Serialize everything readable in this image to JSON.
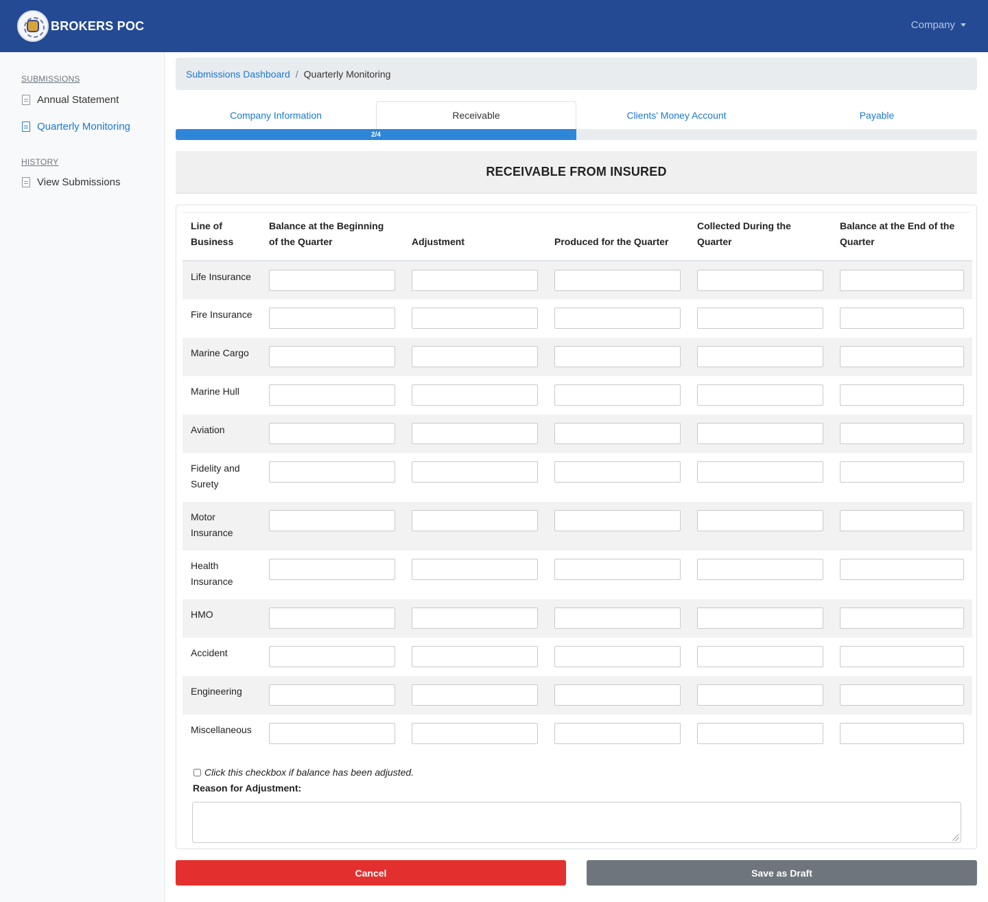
{
  "app": {
    "brand": "BROKERS POC",
    "company_menu": "Company"
  },
  "sidebar": {
    "submissions_heading": "SUBMISSIONS",
    "history_heading": "HISTORY",
    "items": [
      {
        "label": "Annual Statement"
      },
      {
        "label": "Quarterly Monitoring"
      },
      {
        "label": "View Submissions"
      }
    ]
  },
  "breadcrumb": {
    "link": "Submissions Dashboard",
    "separator": "/",
    "current": "Quarterly Monitoring"
  },
  "tabs": [
    {
      "label": "Company Information"
    },
    {
      "label": "Receivable"
    },
    {
      "label": "Clients' Money Account"
    },
    {
      "label": "Payable"
    }
  ],
  "progress": {
    "label": "2/4",
    "fraction": 0.5
  },
  "section": {
    "title": "RECEIVABLE FROM INSURED"
  },
  "table": {
    "headers": [
      "Line of Business",
      "Balance at the Beginning of the Quarter",
      "Adjustment",
      "Produced for the Quarter",
      "Collected During the Quarter",
      "Balance at the End of the Quarter"
    ],
    "rows": [
      "Life Insurance",
      "Fire Insurance",
      "Marine Cargo",
      "Marine Hull",
      "Aviation",
      "Fidelity and Surety",
      "Motor Insurance",
      "Health Insurance",
      "HMO",
      "Accident",
      "Engineering",
      "Miscellaneous"
    ]
  },
  "adjustment": {
    "checkbox_label": "Click this checkbox if balance has been adjusted.",
    "reason_label": "Reason for Adjustment:"
  },
  "buttons": {
    "cancel": "Cancel",
    "save_draft": "Save as Draft"
  },
  "colors": {
    "navbar": "#234a93",
    "accent": "#1b78d4",
    "progress": "#2f86d9",
    "cancel": "#e3302f",
    "draft": "#6e757c"
  }
}
